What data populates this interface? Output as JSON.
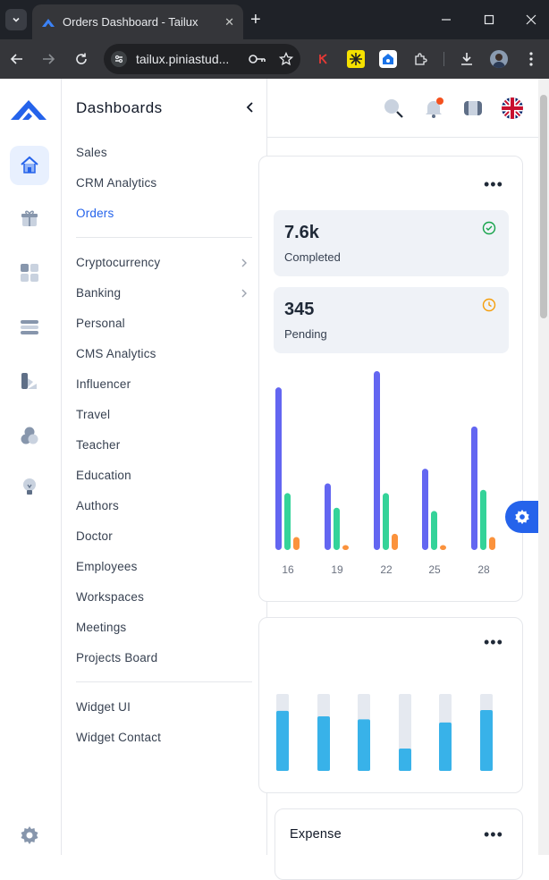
{
  "browser": {
    "tab_title": "Orders Dashboard - Tailux",
    "url": "tailux.piniastud..."
  },
  "sidebar": {
    "title": "Dashboards",
    "groups": [
      [
        "Sales",
        "CRM Analytics",
        "Orders"
      ],
      [
        "Cryptocurrency",
        "Banking",
        "Personal",
        "CMS Analytics",
        "Influencer",
        "Travel",
        "Teacher",
        "Education",
        "Authors",
        "Doctor",
        "Employees",
        "Workspaces",
        "Meetings",
        "Projects Board"
      ],
      [
        "Widget UI",
        "Widget Contact"
      ]
    ],
    "active_item": "Orders"
  },
  "stats": {
    "completed_value": "7.6k",
    "completed_label": "Completed",
    "pending_value": "345",
    "pending_label": "Pending"
  },
  "chart_data": [
    {
      "type": "bar",
      "categories": [
        "16",
        "19",
        "22",
        "25",
        "28"
      ],
      "series": [
        {
          "values": [
            100,
            41,
            110,
            50,
            76
          ],
          "color": "#6366f1"
        },
        {
          "values": [
            35,
            26,
            35,
            24,
            37
          ],
          "color": "#34d399"
        },
        {
          "values": [
            8,
            3,
            10,
            3,
            8
          ],
          "color": "#fb923c"
        }
      ],
      "ylim": [
        0,
        110
      ]
    },
    {
      "type": "bar",
      "stacked_track": true,
      "values": [
        78,
        71,
        67,
        29,
        63,
        79
      ],
      "max": 100,
      "color": "#38b2e9",
      "track_color": "#e5e9f0"
    }
  ],
  "expense": {
    "title": "Expense"
  },
  "colors": {
    "accent": "#2563eb",
    "completed": "#16a34a",
    "pending": "#f59e0b"
  }
}
